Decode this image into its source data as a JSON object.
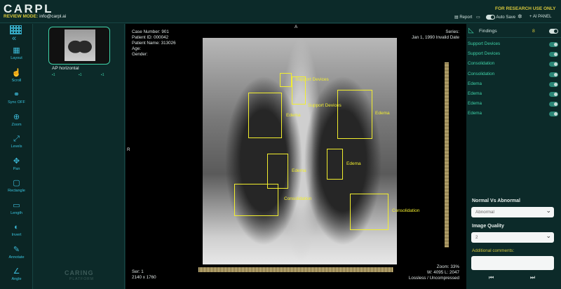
{
  "header": {
    "logo": "CARPL",
    "review_mode_label": "REVIEW MODE:",
    "review_email": "info@carpl.ai",
    "research_notice": "FOR RESEARCH USE ONLY",
    "report_label": "Report",
    "autosave_label": "Auto Save",
    "ai_panel_label": "AI PANEL"
  },
  "toolbar": {
    "items": [
      {
        "label": "Layout",
        "icon": "layout-icon"
      },
      {
        "label": "Scroll",
        "icon": "scroll-icon"
      },
      {
        "label": "Sync OFF",
        "icon": "sync-icon"
      },
      {
        "label": "Zoom",
        "icon": "zoom-icon"
      },
      {
        "label": "Levels",
        "icon": "levels-icon"
      },
      {
        "label": "Pan",
        "icon": "pan-icon"
      },
      {
        "label": "Rectangle",
        "icon": "rectangle-icon"
      },
      {
        "label": "Length",
        "icon": "length-icon"
      },
      {
        "label": "Invert",
        "icon": "invert-icon"
      },
      {
        "label": "Annotate",
        "icon": "annotate-icon"
      },
      {
        "label": "Angle",
        "icon": "angle-icon"
      }
    ]
  },
  "series": {
    "thumb_label": "AP horizontal",
    "count_a": "1",
    "count_b": "1",
    "count_c": "1",
    "brand": "CARING",
    "brand_sub": "PLATFORM"
  },
  "viewer": {
    "top_marker": "A",
    "left_marker": "R",
    "case_number": "Case Number: 901",
    "patient_id": "Patient ID: 000042",
    "patient_name": "Patient Name: 313026",
    "age": "Age:",
    "gender": "Gender:",
    "series_label": "Series:",
    "series_date": "Jan 1, 1990 Invalid Date",
    "ser": "Ser: 1",
    "dims": "2140 x 1760",
    "zoom": "Zoom: 33%",
    "window": "W: 4095 L: 2047",
    "compression": "Lossless / Uncompressed"
  },
  "annotations": [
    "Support Devices",
    "Support Devices",
    "Edema",
    "Edema",
    "Edema",
    "Edema",
    "Consolidation",
    "Consolidation"
  ],
  "findings": {
    "title": "Findings",
    "count": "8",
    "items": [
      "Support Devices",
      "Support Devices",
      "Consolidation",
      "Consolidation",
      "Edema",
      "Edema",
      "Edema",
      "Edema"
    ]
  },
  "form": {
    "q1_label": "Normal Vs Abnormal",
    "q1_value": "Abnormal",
    "q2_label": "Image Quality",
    "q2_value": "2",
    "comments_label": "Additional comments:"
  },
  "colors": {
    "accent": "#3fd3a8",
    "annotation": "#f2ee2e",
    "warning": "#d7c73a"
  }
}
